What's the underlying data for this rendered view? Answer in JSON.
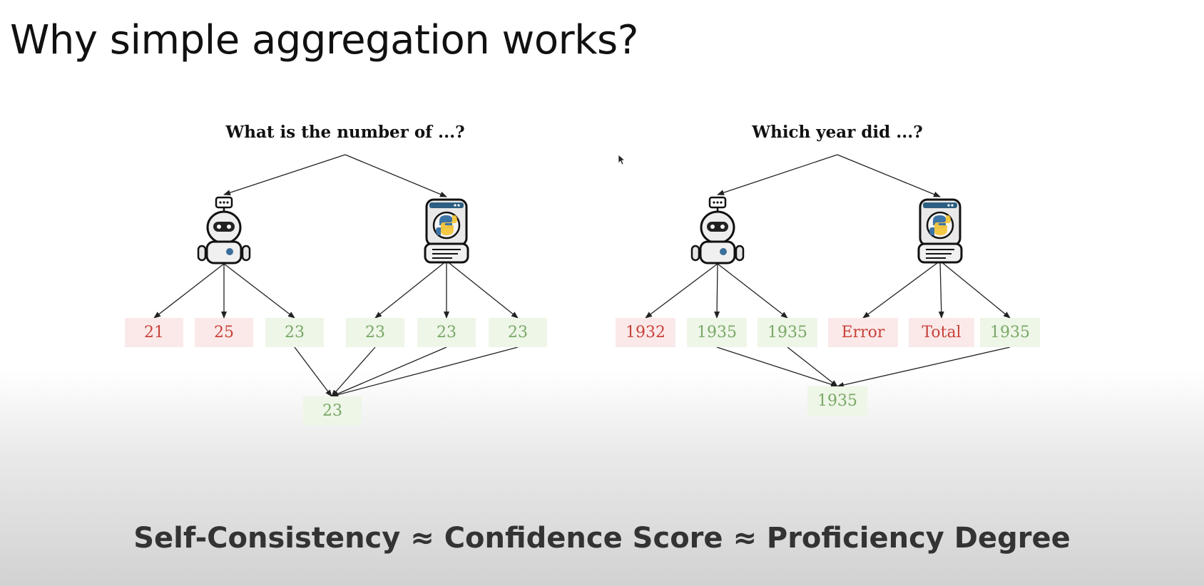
{
  "slide": {
    "title": "Why simple aggregation works?",
    "formula": "Self-Consistency ≈ Confidence Score ≈ Proficiency Degree"
  },
  "left_tree": {
    "question": "What is the number of ...?",
    "llm_answers": [
      {
        "text": "21",
        "status": "wrong"
      },
      {
        "text": "25",
        "status": "wrong"
      },
      {
        "text": "23",
        "status": "correct"
      }
    ],
    "code_answers": [
      {
        "text": "23",
        "status": "correct"
      },
      {
        "text": "23",
        "status": "correct"
      },
      {
        "text": "23",
        "status": "correct"
      }
    ],
    "final": "23"
  },
  "right_tree": {
    "question": "Which year did ...?",
    "llm_answers": [
      {
        "text": "1932",
        "status": "wrong"
      },
      {
        "text": "1935",
        "status": "correct"
      },
      {
        "text": "1935",
        "status": "correct"
      }
    ],
    "code_answers": [
      {
        "text": "Error",
        "status": "wrong"
      },
      {
        "text": "Total",
        "status": "wrong"
      },
      {
        "text": "1935",
        "status": "correct"
      }
    ],
    "final": "1935"
  },
  "icons": {
    "llm_agent": "robot-chat-icon",
    "code_agent": "python-code-robot-icon"
  },
  "colors": {
    "wrong_text": "#c8423a",
    "wrong_bg": "#fbe9e9",
    "correct_text": "#79a865",
    "correct_bg": "#eef6e8"
  }
}
